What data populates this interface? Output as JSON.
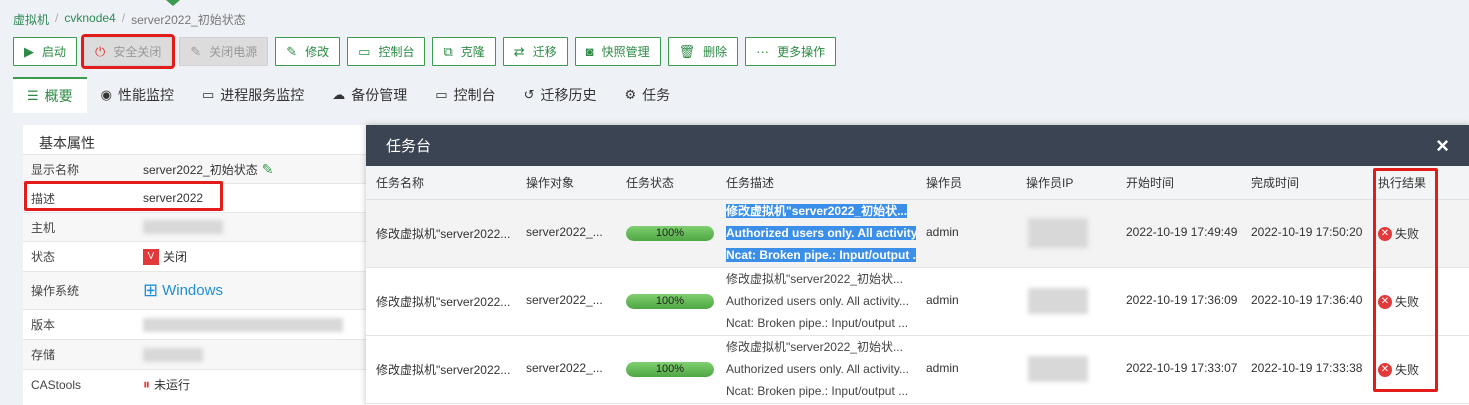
{
  "breadcrumb": [
    "虚拟机",
    "cvknode4",
    "server2022_初始状态"
  ],
  "toolbar": {
    "start": "启动",
    "safe_shutdown": "安全关闭",
    "power_off": "关闭电源",
    "edit": "修改",
    "console": "控制台",
    "clone": "克隆",
    "migrate": "迁移",
    "snapshot": "快照管理",
    "delete": "删除",
    "more": "更多操作"
  },
  "tabs": [
    "概要",
    "性能监控",
    "进程服务监控",
    "备份管理",
    "控制台",
    "迁移历史",
    "任务"
  ],
  "basic": {
    "title": "基本属性",
    "rows": [
      {
        "label": "显示名称",
        "value": "server2022_初始状态"
      },
      {
        "label": "描述",
        "value": "server2022"
      },
      {
        "label": "主机",
        "value": ""
      },
      {
        "label": "状态",
        "value": "关闭"
      },
      {
        "label": "操作系统",
        "value": "Windows"
      },
      {
        "label": "版本",
        "value": ""
      },
      {
        "label": "存储",
        "value": ""
      },
      {
        "label": "CAStools",
        "value": "未运行"
      }
    ]
  },
  "task_modal": {
    "title": "任务台",
    "close": "×",
    "columns": [
      "任务名称",
      "操作对象",
      "任务状态",
      "任务描述",
      "操作员",
      "操作员IP",
      "开始时间",
      "完成时间",
      "执行结果"
    ],
    "rows": [
      {
        "name": "修改虚拟机\"server2022...",
        "target": "server2022_...",
        "progress": "100%",
        "desc": [
          "修改虚拟机\"server2022_初始状...",
          "Authorized users only. All activity...",
          "Ncat: Broken pipe.: Input/output ..."
        ],
        "operator": "admin",
        "start": "2022-10-19 17:49:49",
        "end": "2022-10-19 17:50:20",
        "result": "失败"
      },
      {
        "name": "修改虚拟机\"server2022...",
        "target": "server2022_...",
        "progress": "100%",
        "desc": [
          "修改虚拟机\"server2022_初始状...",
          "Authorized users only. All activity...",
          "Ncat: Broken pipe.: Input/output ..."
        ],
        "operator": "admin",
        "start": "2022-10-19 17:36:09",
        "end": "2022-10-19 17:36:40",
        "result": "失败"
      },
      {
        "name": "修改虚拟机\"server2022...",
        "target": "server2022_...",
        "progress": "100%",
        "desc": [
          "修改虚拟机\"server2022_初始状...",
          "Authorized users only. All activity...",
          "Ncat: Broken pipe.: Input/output ..."
        ],
        "operator": "admin",
        "start": "2022-10-19 17:33:07",
        "end": "2022-10-19 17:33:38",
        "result": "失败"
      }
    ]
  },
  "colors": {
    "accent": "#3a9a4e",
    "highlight": "#e21b1b",
    "modal_header": "#3a4452",
    "selection": "#3b8fe8"
  }
}
